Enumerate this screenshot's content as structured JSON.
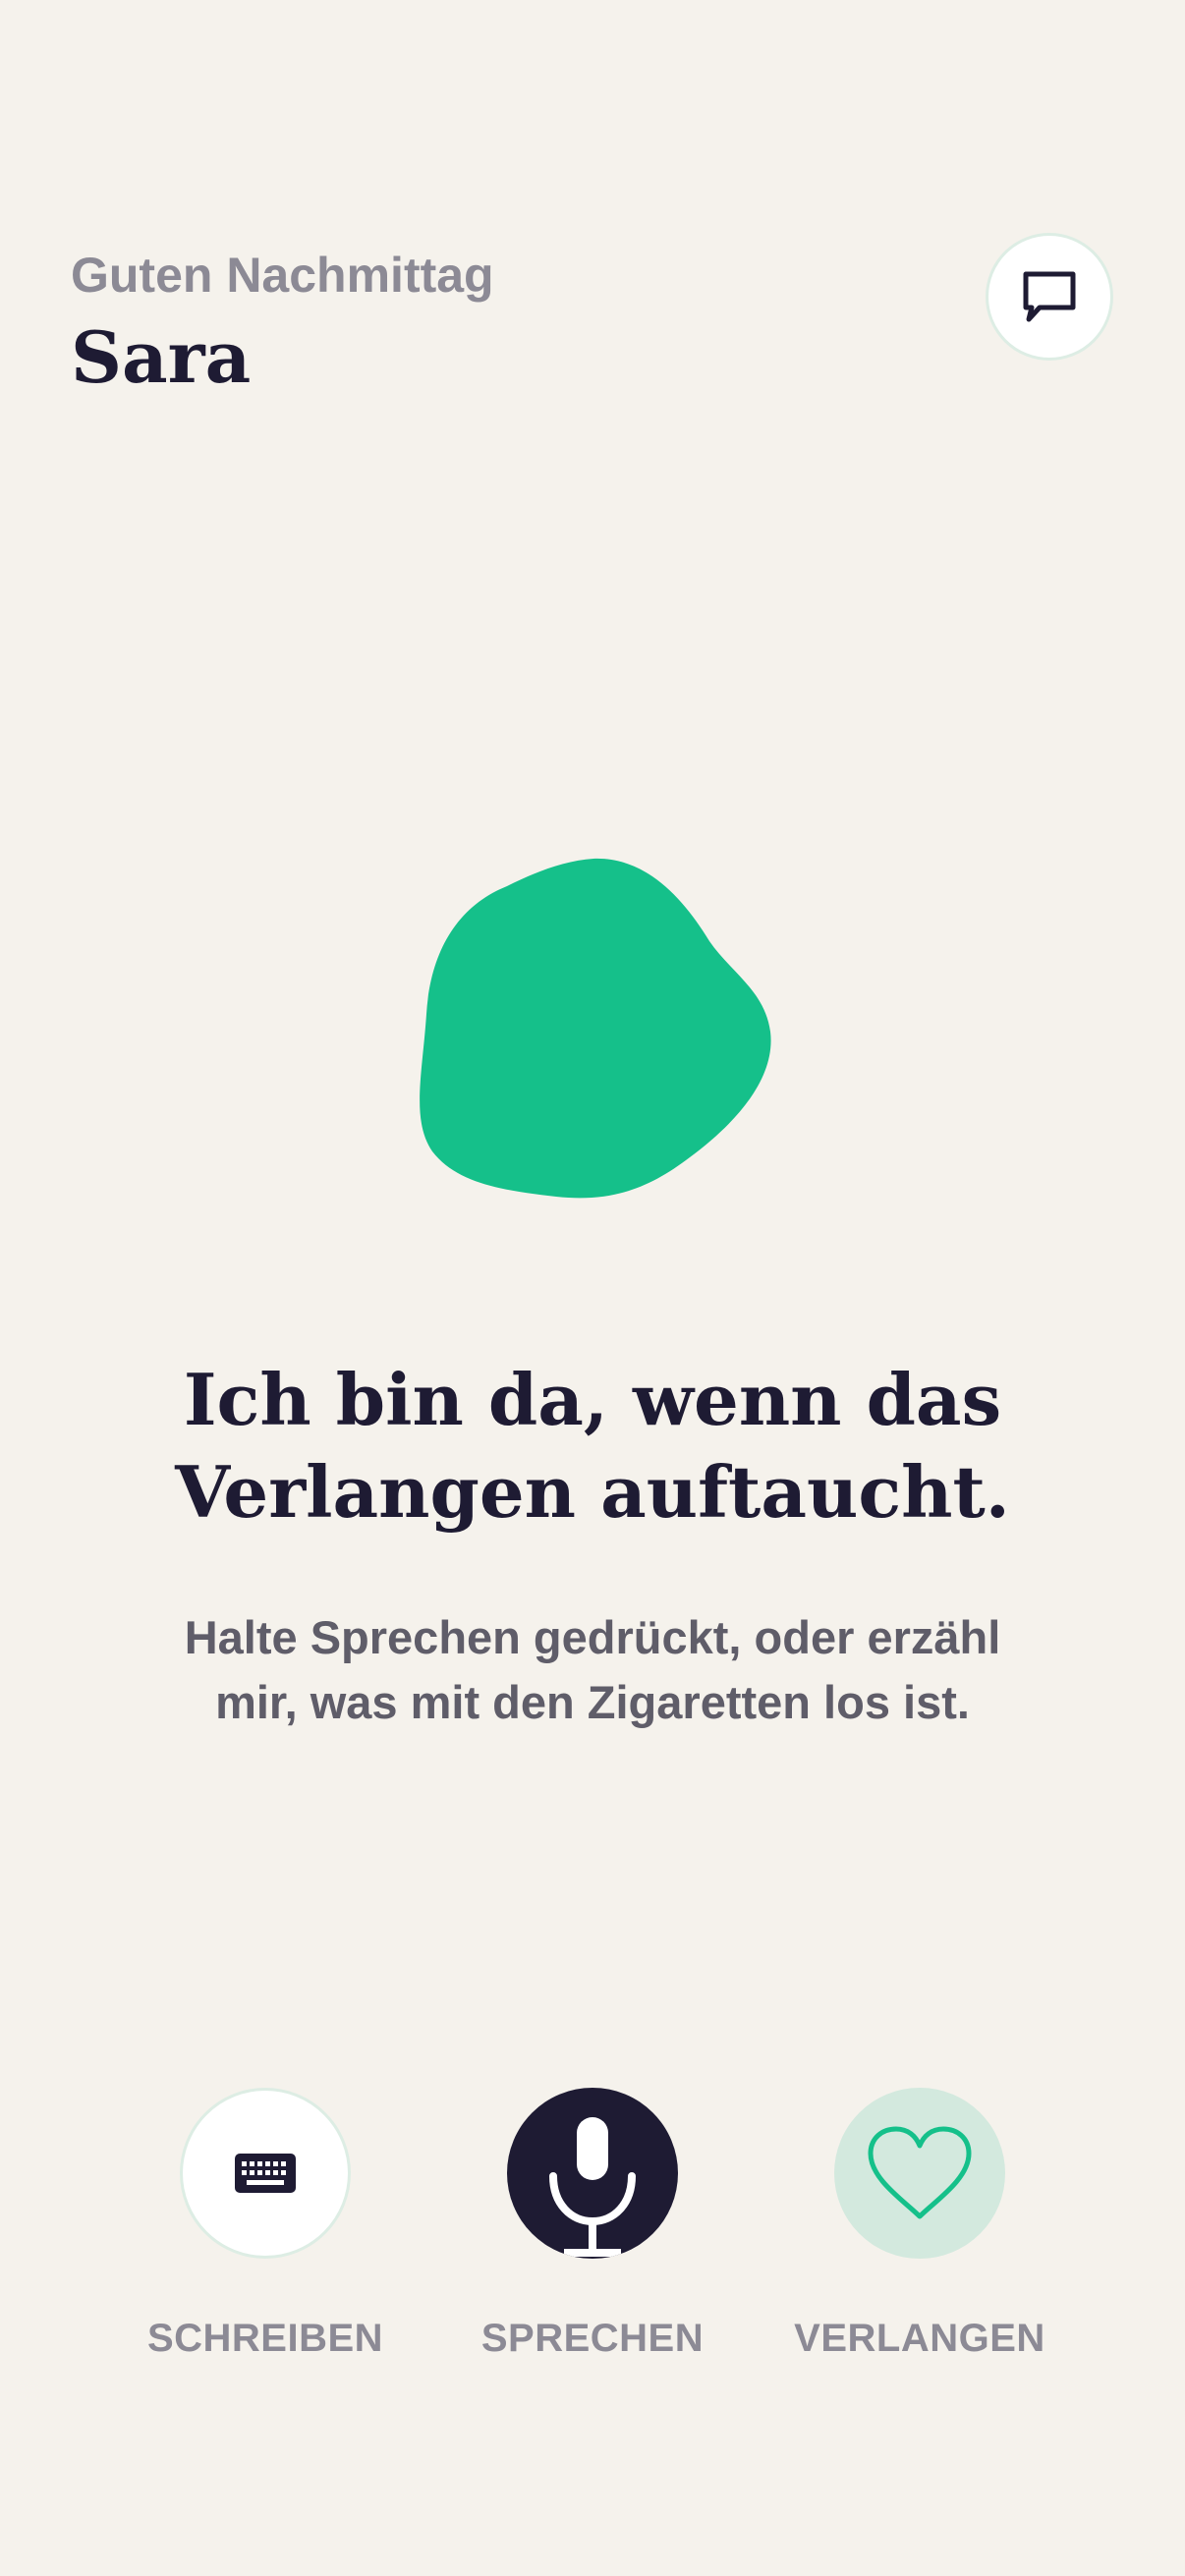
{
  "header": {
    "greeting": "Guten Nachmittag",
    "user_name": "Sara",
    "chat_icon": "speech-bubble-icon"
  },
  "main": {
    "orb_color": "#15C08A",
    "headline_line1": "Ich bin da, wenn das",
    "headline_line2": "Verlangen auftaucht.",
    "subline_line1": "Halte Sprechen gedrückt, oder erzähl",
    "subline_line2": "mir, was mit den Zigaretten los ist."
  },
  "actions": [
    {
      "label": "SCHREIBEN",
      "icon": "keyboard-icon"
    },
    {
      "label": "SPRECHEN",
      "icon": "microphone-icon"
    },
    {
      "label": "VERLANGEN",
      "icon": "heart-icon"
    }
  ],
  "colors": {
    "background": "#F5F2EC",
    "primary_dark": "#1E1B33",
    "accent_green": "#15C08A",
    "muted_text": "#8C8A95"
  }
}
